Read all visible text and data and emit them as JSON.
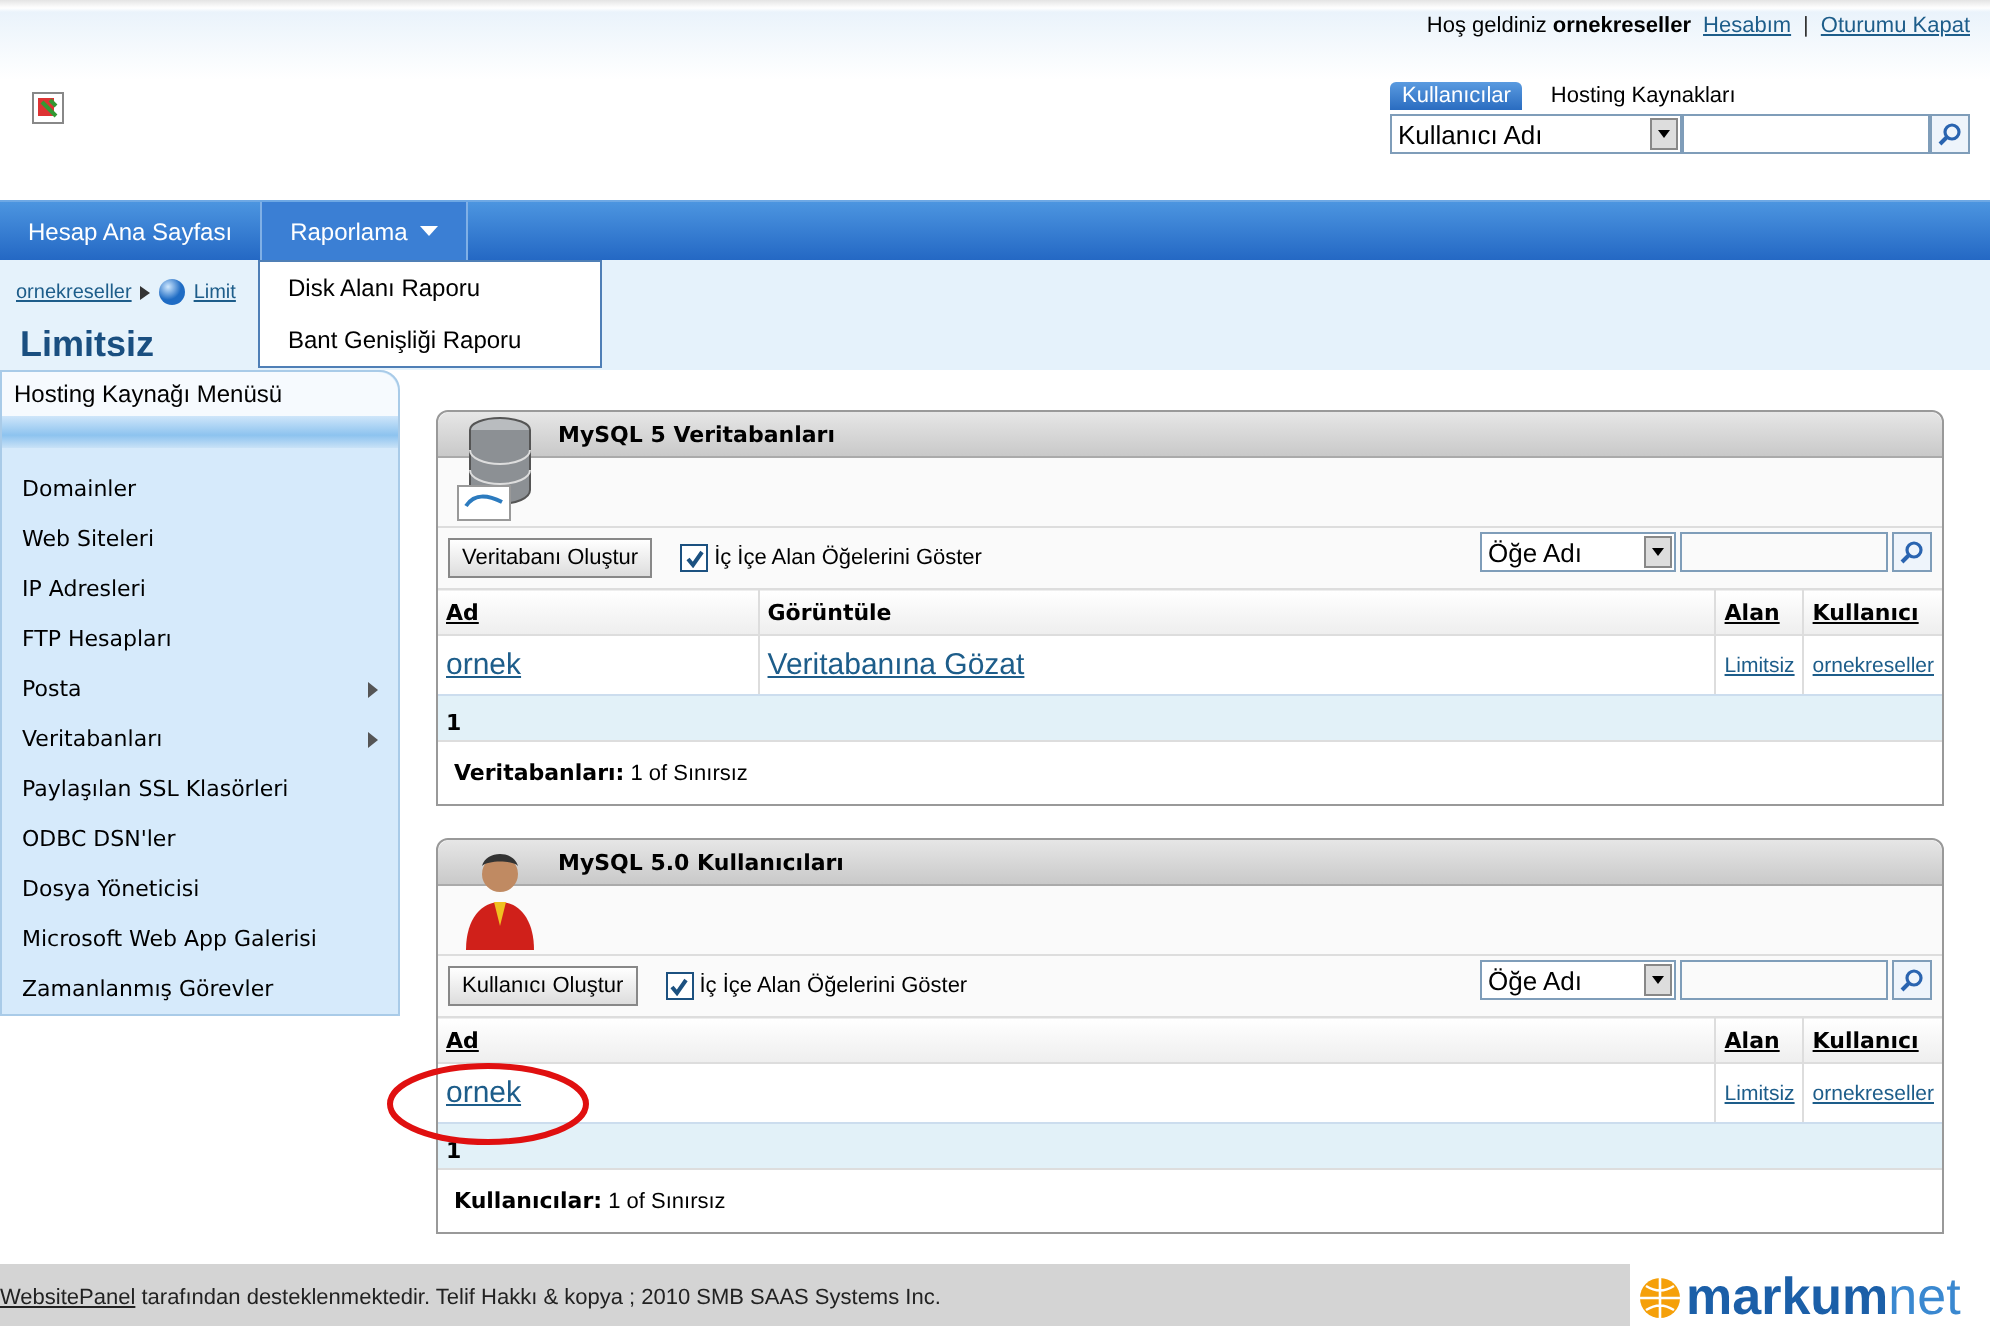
{
  "header": {
    "welcome": "Hoş geldiniz",
    "user": "ornekreseller",
    "links": [
      "Hesabım",
      "Oturumu Kapat"
    ],
    "link_separator": "|",
    "search_tabs": [
      {
        "label": "Kullanıcılar",
        "selected": true
      },
      {
        "label": "Hosting Kaynakları",
        "selected": false
      }
    ],
    "search_select": "Kullanıcı Adı"
  },
  "nav": {
    "items": [
      {
        "label": "Hesap Ana Sayfası",
        "has_menu": false,
        "expanded": false
      },
      {
        "label": "Raporlama",
        "has_menu": true,
        "expanded": true
      }
    ],
    "menu": [
      "Disk Alanı Raporu",
      "Bant Genişliği Raporu"
    ]
  },
  "breadcrumb": [
    "ornekreseller",
    "Limit"
  ],
  "page_title": "Limitsiz",
  "sidebar": {
    "title": "Hosting Kaynağı Menüsü",
    "items": [
      {
        "label": "Domainler",
        "submenu": false
      },
      {
        "label": "Web Siteleri",
        "submenu": false
      },
      {
        "label": "IP Adresleri",
        "submenu": false
      },
      {
        "label": "FTP Hesapları",
        "submenu": false
      },
      {
        "label": "Posta",
        "submenu": true
      },
      {
        "label": "Veritabanları",
        "submenu": true
      },
      {
        "label": "Paylaşılan SSL Klasörleri",
        "submenu": false
      },
      {
        "label": "ODBC DSN'ler",
        "submenu": false
      },
      {
        "label": "Dosya Yöneticisi",
        "submenu": false
      },
      {
        "label": "Microsoft Web App Galerisi",
        "submenu": false
      },
      {
        "label": "Zamanlanmış Görevler",
        "submenu": false
      }
    ]
  },
  "panels": [
    {
      "kind": "database",
      "title": "MySQL 5 Veritabanları",
      "create_button": "Veritabanı Oluştur",
      "checkbox": {
        "label": "İç İçe Alan Öğelerini Göster",
        "checked": true
      },
      "filter_select": "Öğe Adı",
      "columns": [
        {
          "label": "Ad",
          "sortable": true
        },
        {
          "label": "Görüntüle",
          "sortable": false
        },
        {
          "label": "Alan",
          "sortable": true
        },
        {
          "label": "Kullanıcı",
          "sortable": true
        }
      ],
      "rows": [
        [
          "ornek",
          "Veritabanına Gözat",
          "Limitsiz",
          "ornekreseller"
        ]
      ],
      "pager": "1",
      "summary_label": "Veritabanları:",
      "summary": "1 of Sınırsız",
      "highlighted": false
    },
    {
      "kind": "user",
      "title": "MySQL 5.0 Kullanıcıları",
      "create_button": "Kullanıcı Oluştur",
      "checkbox": {
        "label": "İç İçe Alan Öğelerini Göster",
        "checked": true
      },
      "filter_select": "Öğe Adı",
      "columns": [
        {
          "label": "Ad",
          "sortable": true
        },
        {
          "label": "Alan",
          "sortable": true
        },
        {
          "label": "Kullanıcı",
          "sortable": true
        }
      ],
      "rows": [
        [
          "ornek",
          "Limitsiz",
          "ornekreseller"
        ]
      ],
      "pager": "1",
      "summary_label": "Kullanıcılar:",
      "summary": "1 of Sınırsız",
      "highlighted": true
    }
  ],
  "footer": {
    "link": "WebsitePanel",
    "text": "tarafından desteklenmektedir. Telif Hakkı & kopya ; 2010 SMB SAAS Systems Inc.",
    "logo": [
      "markum",
      "net"
    ]
  }
}
